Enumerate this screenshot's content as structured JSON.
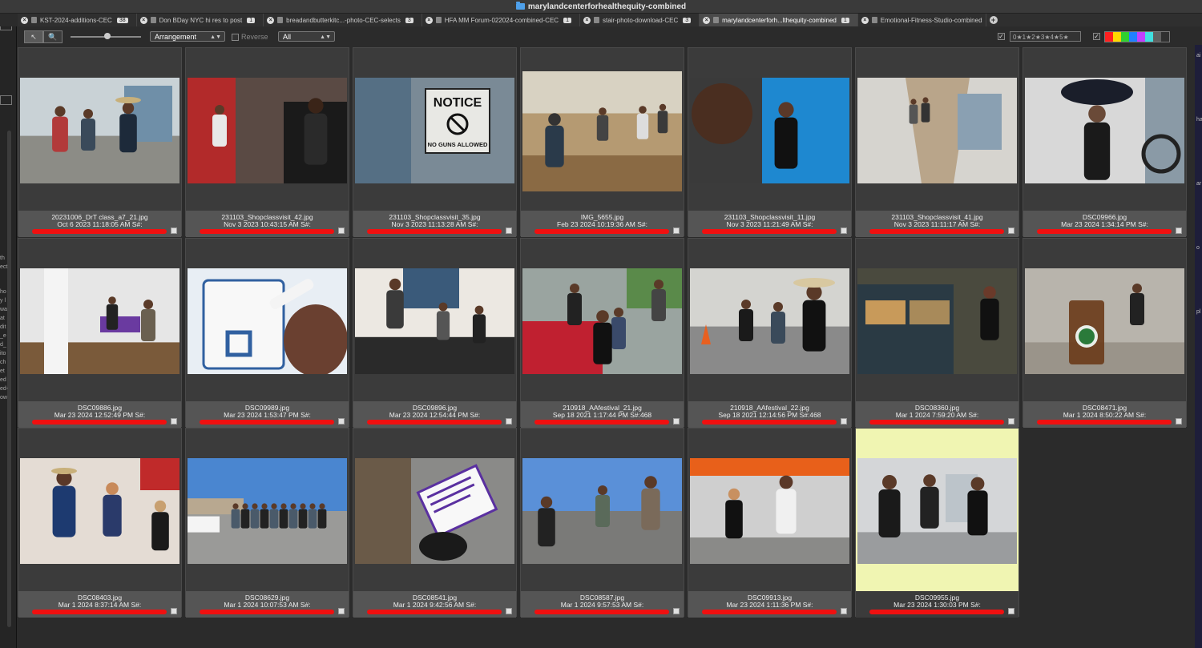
{
  "window": {
    "title": "marylandcenterforhealthequity-combined"
  },
  "tabs": [
    {
      "label": "KST-2024-additions-CEC",
      "count": "38",
      "active": false
    },
    {
      "label": "Don BDay NYC hi res to post",
      "count": "1",
      "active": false
    },
    {
      "label": "breadandbutterkitc...-photo-CEC-selects",
      "count": "3",
      "active": false
    },
    {
      "label": "HFA MM Forum-022024-combined-CEC",
      "count": "1",
      "active": false
    },
    {
      "label": "stair-photo-download-CEC",
      "count": "3",
      "active": false
    },
    {
      "label": "marylandcenterforh...lthequity-combined",
      "count": "1",
      "active": true
    },
    {
      "label": "Emotional-Fitness-Studio-combined",
      "count": "",
      "active": false
    }
  ],
  "toolbar": {
    "arrow_tool": "↖",
    "zoom_tool": "🔍",
    "sort_select": "Arrangement",
    "reverse_label": "Reverse",
    "filter_select": "All",
    "stars_filter": "0★1★2★3★4★5★",
    "swatch_colors": [
      "#ff2020",
      "#ffd800",
      "#30d030",
      "#2080ff",
      "#c040ff",
      "#40e0e0",
      "#606060",
      "#303030"
    ]
  },
  "left_panel": {
    "tags": [
      "th",
      "ect",
      "ho",
      "y l",
      "wa",
      "at",
      "dit",
      "_e",
      "d_",
      "ito",
      "ch",
      "et",
      "ed",
      "ed-",
      "ow"
    ]
  },
  "right_panel": {
    "tags": [
      "ai",
      "ha",
      "ar",
      "o",
      "pl"
    ]
  },
  "thumbnails": [
    {
      "filename": "20231006_DrT class_a7_21.jpg",
      "meta": "Oct 6 2023 11:18:05 AM S#:",
      "scene": "people",
      "selected": false
    },
    {
      "filename": "231103_Shopclassvisit_42.jpg",
      "meta": "Nov 3 2023 10:43:15 AM S#:",
      "scene": "barber",
      "selected": false
    },
    {
      "filename": "231103_Shopclassvisit_35.jpg",
      "meta": "Nov 3 2023 11:13:28 AM S#:",
      "scene": "notice",
      "notice_text": "NOTICE",
      "notice_sub": "NO GUNS ALLOWED",
      "selected": false
    },
    {
      "filename": "IMG_5655.jpg",
      "meta": "Feb 23 2024 10:19:36 AM S#:",
      "scene": "shop",
      "selected": false
    },
    {
      "filename": "231103_Shopclassvisit_11.jpg",
      "meta": "Nov 3 2023 11:21:49 AM S#:",
      "scene": "portrait-blue",
      "selected": false
    },
    {
      "filename": "231103_Shopclassvisit_41.jpg",
      "meta": "Nov 3 2023 11:11:17 AM S#:",
      "scene": "hallway",
      "selected": false
    },
    {
      "filename": "DSC09966.jpg",
      "meta": "Mar 23 2024 1:34:14 PM S#:",
      "scene": "driver",
      "selected": false
    },
    {
      "filename": "DSC09886.jpg",
      "meta": "Mar 23 2024 12:52:49 PM S#:",
      "scene": "office",
      "selected": false
    },
    {
      "filename": "DSC09989.jpg",
      "meta": "Mar 23 2024 1:53:47 PM S#:",
      "scene": "test",
      "selected": false
    },
    {
      "filename": "DSC09896.jpg",
      "meta": "Mar 23 2024 12:54:44 PM S#:",
      "scene": "clinic",
      "selected": false
    },
    {
      "filename": "210918_AAfestival_21.jpg",
      "meta": "Sep 18 2021 1:17:44 PM S#:468",
      "scene": "festival",
      "selected": false
    },
    {
      "filename": "210918_AAfestival_22.jpg",
      "meta": "Sep 18 2021 12:14:56 PM S#:468",
      "scene": "tent",
      "selected": false
    },
    {
      "filename": "DSC08360.jpg",
      "meta": "Mar 1 2024 7:59:20 AM S#:",
      "scene": "bakery",
      "selected": false
    },
    {
      "filename": "DSC08471.jpg",
      "meta": "Mar 1 2024 8:50:22 AM S#:",
      "scene": "cafe",
      "selected": false
    },
    {
      "filename": "DSC08403.jpg",
      "meta": "Mar 1 2024 8:37:14 AM S#:",
      "scene": "restaurant",
      "selected": false
    },
    {
      "filename": "DSC08629.jpg",
      "meta": "Mar 1 2024 10:07:53 AM S#:",
      "scene": "line",
      "selected": false
    },
    {
      "filename": "DSC08541.jpg",
      "meta": "Mar 1 2024 9:42:56 AM S#:",
      "scene": "card",
      "selected": false
    },
    {
      "filename": "DSC08587.jpg",
      "meta": "Mar 1 2024 9:57:53 AM S#:",
      "scene": "parking",
      "selected": false
    },
    {
      "filename": "DSC09913.jpg",
      "meta": "Mar 23 2024 1:11:36 PM S#:",
      "scene": "storefront",
      "selected": false
    },
    {
      "filename": "DSC09955.jpg",
      "meta": "Mar 23 2024 1:30:03 PM S#:",
      "scene": "street",
      "selected": true
    }
  ]
}
